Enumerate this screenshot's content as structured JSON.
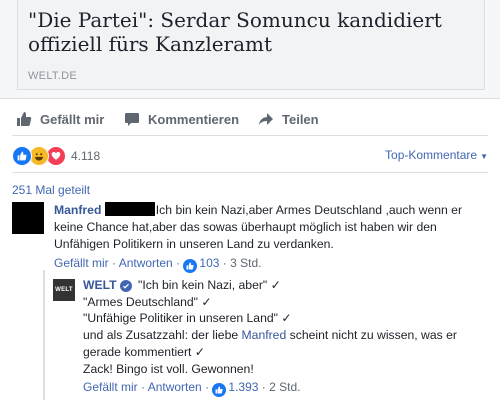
{
  "card": {
    "title": "\"Die Partei\": Serdar Somuncu kandidiert offiziell fürs Kanzleramt",
    "domain": "WELT.DE"
  },
  "actions": {
    "like": "Gefällt mir",
    "comment": "Kommentieren",
    "share": "Teilen"
  },
  "reactions": {
    "count": "4.118",
    "sort_label": "Top-Kommentare"
  },
  "shares": "251 Mal geteilt",
  "comment1": {
    "author": "Manfred",
    "text": "Ich bin kein Nazi,aber Armes Deutschland ,auch wenn er keine Chance hat,aber das sowas überhaupt möglich ist haben wir den Unfähigen Politikern in unseren Land zu verdanken.",
    "like_label": "Gefällt mir",
    "reply_label": "Antworten",
    "likes": "103",
    "time": "3 Std."
  },
  "comment2": {
    "avatar_text": "WELT",
    "author": "WELT",
    "line1": "\"Ich bin kein Nazi, aber\" ✓",
    "line2": "\"Armes Deutschland\" ✓",
    "line3": "\"Unfähige Politiker in unseren Land\" ✓",
    "line4_pre": "und als Zusatzzahl: der liebe ",
    "mention": "Manfred",
    "line4_post": " scheint nicht zu wissen, was er gerade kommentiert ✓",
    "line5": "Zack! Bingo ist voll. Gewonnen!",
    "like_label": "Gefällt mir",
    "reply_label": "Antworten",
    "likes": "1.393",
    "time": "2 Std."
  },
  "colors": {
    "link": "#4267b2",
    "author": "#365899",
    "like_blue": "#1877f2",
    "haha_yellow": "#f7b928",
    "love_red": "#f33e58"
  },
  "icons": [
    "thumbs-up-icon",
    "comment-icon",
    "share-arrow-icon",
    "haha-icon",
    "heart-icon",
    "verified-icon",
    "chevron-down-icon"
  ]
}
